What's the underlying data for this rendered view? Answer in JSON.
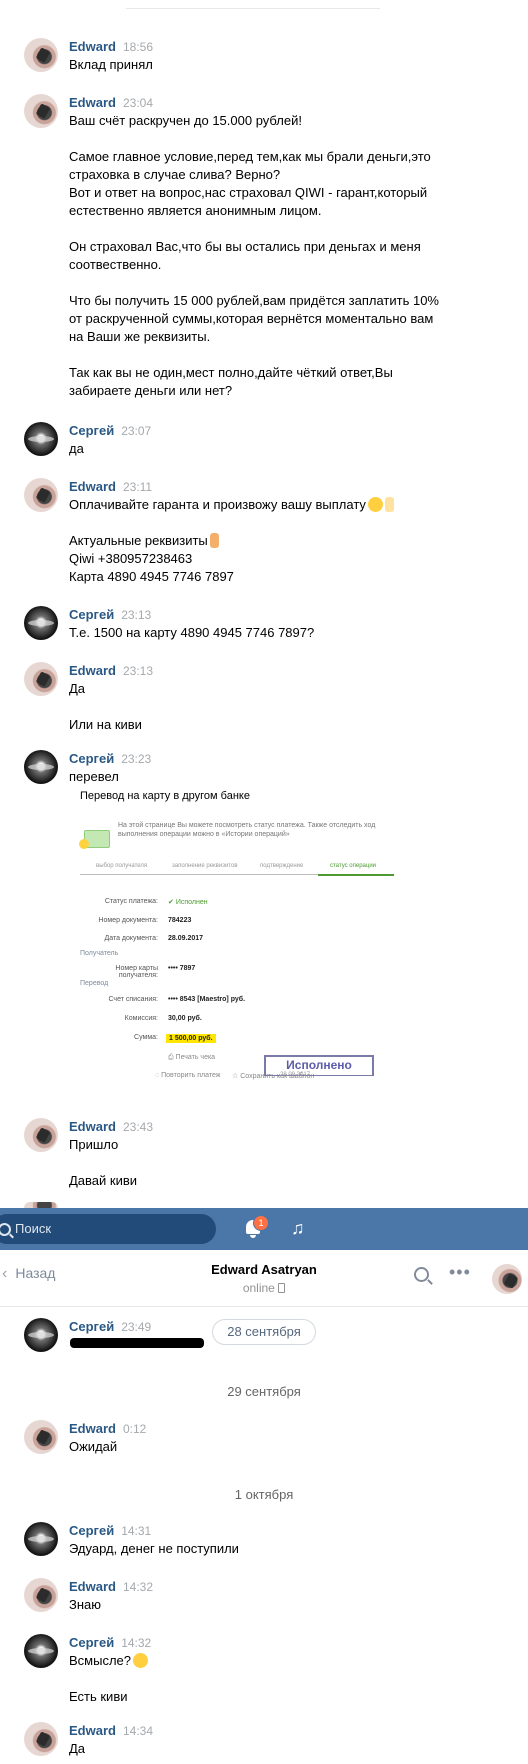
{
  "names": {
    "edward": "Edward",
    "sergey": "Сергей"
  },
  "messages": [
    {
      "author": "Edward",
      "time": "18:56",
      "lines": [
        "Вклад принял"
      ]
    },
    {
      "author": "Edward",
      "time": "23:04",
      "lines": [
        "Ваш счёт раскручен до 15.000 рублей!",
        "",
        "Самое главное условие,перед тем,как мы брали деньги,это",
        "страховка в случае слива? Верно?",
        "Вот и ответ на вопрос,нас страховал QIWI - гарант,который",
        "естественно является анонимным лицом.",
        "",
        "Он страховал Вас,что бы вы остались при деньгах и меня",
        "соотвественно.",
        "",
        "Что бы получить 15 000 рублей,вам придётся заплатить 10%",
        "от раскрученной суммы,которая вернётся моментально вам",
        "на Ваши же реквизиты.",
        "",
        "Так как вы не один,мест полно,дайте чёткий ответ,Вы",
        "забираете деньги или нет?"
      ]
    },
    {
      "author": "Сергей",
      "time": "23:07",
      "lines": [
        "да"
      ]
    },
    {
      "author": "Edward",
      "time": "23:11",
      "lines": [
        "Оплачивайте гаранта и произвожу вашу выплату",
        "",
        "Актуальные реквизиты",
        "Qiwi +380957238463",
        "Карта 4890 4945 7746 7897"
      ]
    },
    {
      "author": "Сергей",
      "time": "23:13",
      "lines": [
        "Т.е. 1500 на карту 4890 4945 7746 7897?"
      ]
    },
    {
      "author": "Edward",
      "time": "23:13",
      "lines": [
        "Да",
        "",
        "Или на киви"
      ]
    },
    {
      "author": "Сергей",
      "time": "23:23",
      "lines": [
        "перевел"
      ]
    },
    {
      "author": "Edward",
      "time": "23:43",
      "lines": [
        "Пришло",
        "",
        "Давай киви"
      ]
    },
    {
      "author": "Сергей",
      "time": "23:49",
      "lines": []
    },
    {
      "author": "Edward",
      "time": "0:12",
      "lines": [
        "Ожидай"
      ]
    },
    {
      "author": "Сергей",
      "time": "14:31",
      "lines": [
        "Эдуард, денег не поступили"
      ]
    },
    {
      "author": "Edward",
      "time": "14:32",
      "lines": [
        "Знаю"
      ]
    },
    {
      "author": "Сергей",
      "time": "14:32",
      "lines": [
        "Всмысле?",
        "",
        "Есть киви"
      ]
    },
    {
      "author": "Edward",
      "time": "14:34",
      "lines": [
        "Да"
      ]
    }
  ],
  "dates": {
    "pill": "28 сентября",
    "sep1": "29 сентября",
    "sep2": "1 октября"
  },
  "receipt": {
    "title": "Перевод на карту в другом банке",
    "info": "На этой странице Вы можете посмотреть статус платежа. Также отследить ход выполнения операции можно в «Истории операций»",
    "steps": [
      "выбор получателя",
      "заполнение реквизитов",
      "подтверждение",
      "статус операции"
    ],
    "status_label": "Статус платежа:",
    "status_value": "Исполнен",
    "doc_no_label": "Номер документа:",
    "doc_no_value": "784223",
    "doc_date_label": "Дата документа:",
    "doc_date_value": "28.09.2017",
    "recipient_group": "Получатель",
    "card_label": "Номер карты получателя:",
    "card_value": "•••• 7897",
    "transfer_group": "Перевод",
    "debit_label": "Счет списания:",
    "debit_value": "•••• 8543  [Maestro]  руб.",
    "fee_label": "Комиссия:",
    "fee_value": "30,00 руб.",
    "sum_label": "Сумма:",
    "sum_value": "1 500,00  руб.",
    "print": "Печать чека",
    "repeat": "Повторить платеж",
    "save": "Сохранить как шаблон",
    "stamp": "Исполнено",
    "stamp_date": "28.09.2017"
  },
  "topbar": {
    "search_placeholder": "Поиск",
    "notif_count": "1"
  },
  "chat_header": {
    "back": "Назад",
    "title": "Edward Asatryan",
    "status": "online"
  },
  "colors": {
    "link": "#2a5885",
    "topbar": "#4a76a8",
    "time": "#a5a9ad"
  }
}
